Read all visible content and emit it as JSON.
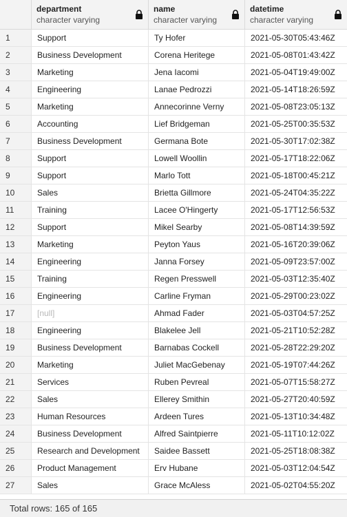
{
  "columns": [
    {
      "name": "department",
      "type": "character varying"
    },
    {
      "name": "name",
      "type": "character varying"
    },
    {
      "name": "datetime",
      "type": "character varying"
    }
  ],
  "null_label": "[null]",
  "rows": [
    {
      "n": "1",
      "department": "Support",
      "name": "Ty Hofer",
      "datetime": "2021-05-30T05:43:46Z"
    },
    {
      "n": "2",
      "department": "Business Development",
      "name": "Corena Heritege",
      "datetime": "2021-05-08T01:43:42Z"
    },
    {
      "n": "3",
      "department": "Marketing",
      "name": "Jena Iacomi",
      "datetime": "2021-05-04T19:49:00Z"
    },
    {
      "n": "4",
      "department": "Engineering",
      "name": "Lanae Pedrozzi",
      "datetime": "2021-05-14T18:26:59Z"
    },
    {
      "n": "5",
      "department": "Marketing",
      "name": "Annecorinne Verny",
      "datetime": "2021-05-08T23:05:13Z"
    },
    {
      "n": "6",
      "department": "Accounting",
      "name": "Lief Bridgeman",
      "datetime": "2021-05-25T00:35:53Z"
    },
    {
      "n": "7",
      "department": "Business Development",
      "name": "Germana Bote",
      "datetime": "2021-05-30T17:02:38Z"
    },
    {
      "n": "8",
      "department": "Support",
      "name": "Lowell Woollin",
      "datetime": "2021-05-17T18:22:06Z"
    },
    {
      "n": "9",
      "department": "Support",
      "name": "Marlo Tott",
      "datetime": "2021-05-18T00:45:21Z"
    },
    {
      "n": "10",
      "department": "Sales",
      "name": "Brietta Gillmore",
      "datetime": "2021-05-24T04:35:22Z"
    },
    {
      "n": "11",
      "department": "Training",
      "name": "Lacee O'Hingerty",
      "datetime": "2021-05-17T12:56:53Z"
    },
    {
      "n": "12",
      "department": "Support",
      "name": "Mikel Searby",
      "datetime": "2021-05-08T14:39:59Z"
    },
    {
      "n": "13",
      "department": "Marketing",
      "name": "Peyton Yaus",
      "datetime": "2021-05-16T20:39:06Z"
    },
    {
      "n": "14",
      "department": "Engineering",
      "name": "Janna Forsey",
      "datetime": "2021-05-09T23:57:00Z"
    },
    {
      "n": "15",
      "department": "Training",
      "name": "Regen Presswell",
      "datetime": "2021-05-03T12:35:40Z"
    },
    {
      "n": "16",
      "department": "Engineering",
      "name": "Carline Fryman",
      "datetime": "2021-05-29T00:23:02Z"
    },
    {
      "n": "17",
      "department": null,
      "name": "Ahmad Fader",
      "datetime": "2021-05-03T04:57:25Z"
    },
    {
      "n": "18",
      "department": "Engineering",
      "name": "Blakelee Jell",
      "datetime": "2021-05-21T10:52:28Z"
    },
    {
      "n": "19",
      "department": "Business Development",
      "name": "Barnabas Cockell",
      "datetime": "2021-05-28T22:29:20Z"
    },
    {
      "n": "20",
      "department": "Marketing",
      "name": "Juliet MacGebenay",
      "datetime": "2021-05-19T07:44:26Z"
    },
    {
      "n": "21",
      "department": "Services",
      "name": "Ruben Pevreal",
      "datetime": "2021-05-07T15:58:27Z"
    },
    {
      "n": "22",
      "department": "Sales",
      "name": "Ellerey Smithin",
      "datetime": "2021-05-27T20:40:59Z"
    },
    {
      "n": "23",
      "department": "Human Resources",
      "name": "Ardeen Tures",
      "datetime": "2021-05-13T10:34:48Z"
    },
    {
      "n": "24",
      "department": "Business Development",
      "name": "Alfred Saintpierre",
      "datetime": "2021-05-11T10:12:02Z"
    },
    {
      "n": "25",
      "department": "Research and Development",
      "name": "Saidee Bassett",
      "datetime": "2021-05-25T18:08:38Z"
    },
    {
      "n": "26",
      "department": "Product Management",
      "name": "Erv Hubane",
      "datetime": "2021-05-03T12:04:54Z"
    },
    {
      "n": "27",
      "department": "Sales",
      "name": "Grace McAless",
      "datetime": "2021-05-02T04:55:20Z"
    }
  ],
  "footer": {
    "total_label": "Total rows: 165 of 165"
  }
}
